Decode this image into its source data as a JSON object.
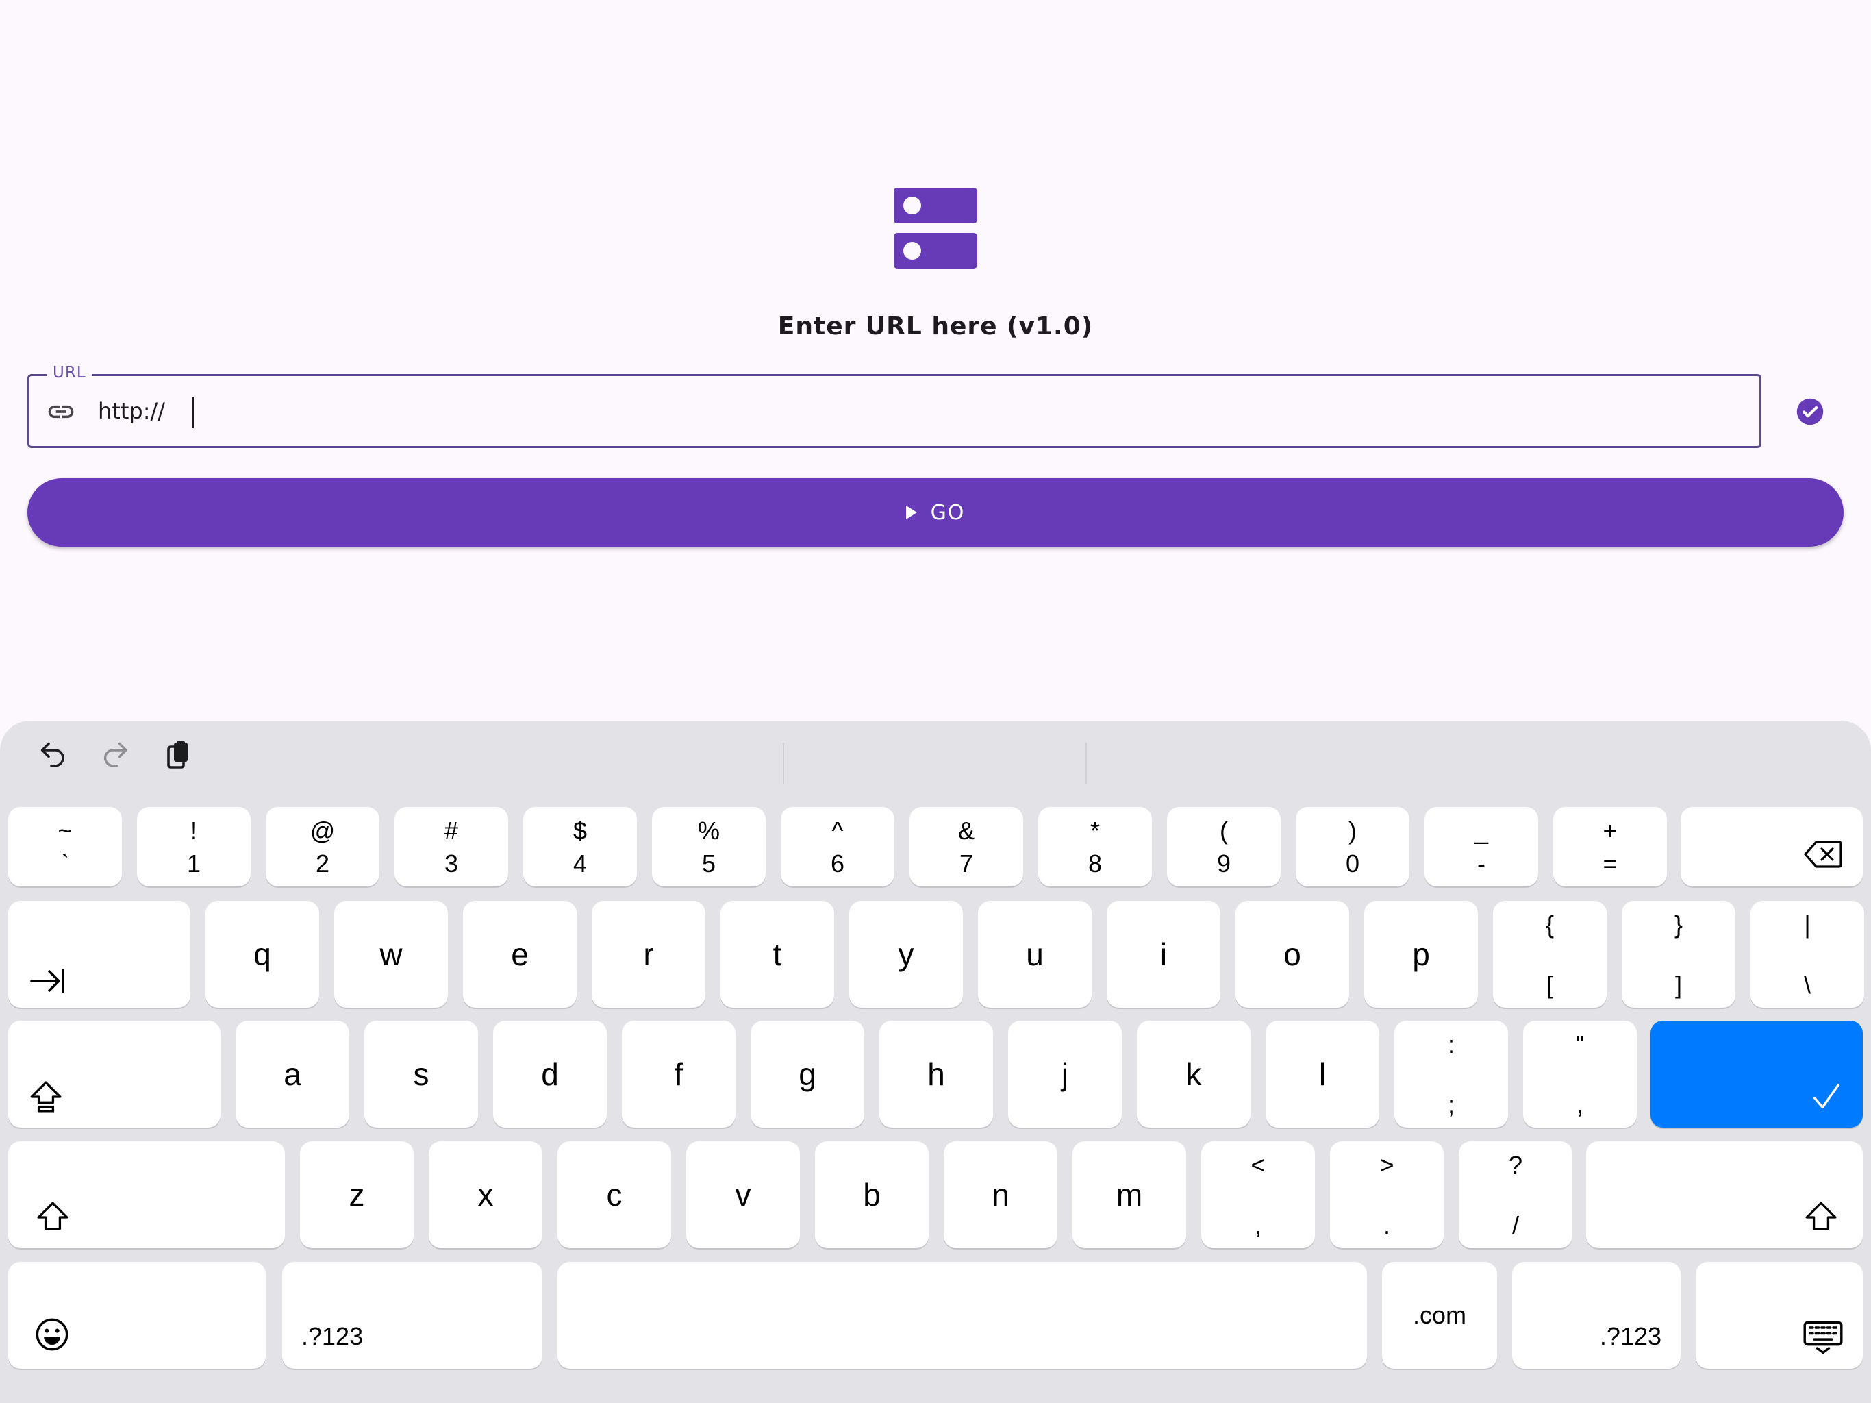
{
  "app": {
    "title": "Enter URL here (v1.0)",
    "url_label": "URL",
    "url_value": "http://",
    "go_label": "GO"
  },
  "colors": {
    "primary": "#673ab7",
    "background": "#fdf7fe",
    "keyboard_bg": "#e2e2e7",
    "enter_key": "#007aff"
  },
  "keyboard": {
    "row1": [
      {
        "top": "~",
        "bot": "`"
      },
      {
        "top": "!",
        "bot": "1"
      },
      {
        "top": "@",
        "bot": "2"
      },
      {
        "top": "#",
        "bot": "3"
      },
      {
        "top": "$",
        "bot": "4"
      },
      {
        "top": "%",
        "bot": "5"
      },
      {
        "top": "^",
        "bot": "6"
      },
      {
        "top": "&",
        "bot": "7"
      },
      {
        "top": "*",
        "bot": "8"
      },
      {
        "top": "(",
        "bot": "9"
      },
      {
        "top": ")",
        "bot": "0"
      },
      {
        "top": "_",
        "bot": "-"
      },
      {
        "top": "+",
        "bot": "="
      }
    ],
    "row2": [
      "q",
      "w",
      "e",
      "r",
      "t",
      "y",
      "u",
      "i",
      "o",
      "p"
    ],
    "row2_sym": [
      {
        "top": "{",
        "bot": "["
      },
      {
        "top": "}",
        "bot": "]"
      },
      {
        "top": "|",
        "bot": "\\"
      }
    ],
    "row3": [
      "a",
      "s",
      "d",
      "f",
      "g",
      "h",
      "j",
      "k",
      "l"
    ],
    "row3_sym": [
      {
        "top": ":",
        "bot": ";"
      },
      {
        "top": "\"",
        "bot": ","
      }
    ],
    "row4": [
      "z",
      "x",
      "c",
      "v",
      "b",
      "n",
      "m"
    ],
    "row4_sym": [
      {
        "top": "<",
        "bot": ","
      },
      {
        "top": ">",
        "bot": "."
      },
      {
        "top": "?",
        "bot": "/"
      }
    ],
    "symbols_label": ".?123",
    "com_label": ".com",
    "icons": {
      "undo": "undo-icon",
      "redo": "redo-icon",
      "clipboard": "clipboard-icon",
      "tab": "tab-icon",
      "shift": "shift-icon",
      "backspace": "backspace-icon",
      "enter": "checkmark-icon",
      "emoji": "emoji-icon",
      "hide_keyboard": "keyboard-hide-icon"
    }
  }
}
